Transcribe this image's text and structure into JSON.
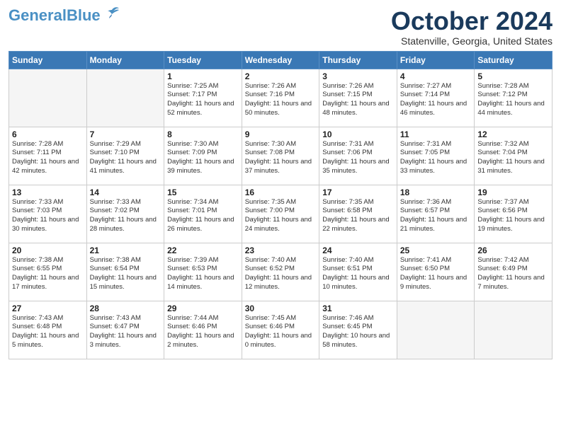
{
  "header": {
    "logo_line1": "General",
    "logo_line2": "Blue",
    "month": "October 2024",
    "location": "Statenville, Georgia, United States"
  },
  "days_of_week": [
    "Sunday",
    "Monday",
    "Tuesday",
    "Wednesday",
    "Thursday",
    "Friday",
    "Saturday"
  ],
  "weeks": [
    [
      {
        "num": "",
        "info": ""
      },
      {
        "num": "",
        "info": ""
      },
      {
        "num": "1",
        "info": "Sunrise: 7:25 AM\nSunset: 7:17 PM\nDaylight: 11 hours and 52 minutes."
      },
      {
        "num": "2",
        "info": "Sunrise: 7:26 AM\nSunset: 7:16 PM\nDaylight: 11 hours and 50 minutes."
      },
      {
        "num": "3",
        "info": "Sunrise: 7:26 AM\nSunset: 7:15 PM\nDaylight: 11 hours and 48 minutes."
      },
      {
        "num": "4",
        "info": "Sunrise: 7:27 AM\nSunset: 7:14 PM\nDaylight: 11 hours and 46 minutes."
      },
      {
        "num": "5",
        "info": "Sunrise: 7:28 AM\nSunset: 7:12 PM\nDaylight: 11 hours and 44 minutes."
      }
    ],
    [
      {
        "num": "6",
        "info": "Sunrise: 7:28 AM\nSunset: 7:11 PM\nDaylight: 11 hours and 42 minutes."
      },
      {
        "num": "7",
        "info": "Sunrise: 7:29 AM\nSunset: 7:10 PM\nDaylight: 11 hours and 41 minutes."
      },
      {
        "num": "8",
        "info": "Sunrise: 7:30 AM\nSunset: 7:09 PM\nDaylight: 11 hours and 39 minutes."
      },
      {
        "num": "9",
        "info": "Sunrise: 7:30 AM\nSunset: 7:08 PM\nDaylight: 11 hours and 37 minutes."
      },
      {
        "num": "10",
        "info": "Sunrise: 7:31 AM\nSunset: 7:06 PM\nDaylight: 11 hours and 35 minutes."
      },
      {
        "num": "11",
        "info": "Sunrise: 7:31 AM\nSunset: 7:05 PM\nDaylight: 11 hours and 33 minutes."
      },
      {
        "num": "12",
        "info": "Sunrise: 7:32 AM\nSunset: 7:04 PM\nDaylight: 11 hours and 31 minutes."
      }
    ],
    [
      {
        "num": "13",
        "info": "Sunrise: 7:33 AM\nSunset: 7:03 PM\nDaylight: 11 hours and 30 minutes."
      },
      {
        "num": "14",
        "info": "Sunrise: 7:33 AM\nSunset: 7:02 PM\nDaylight: 11 hours and 28 minutes."
      },
      {
        "num": "15",
        "info": "Sunrise: 7:34 AM\nSunset: 7:01 PM\nDaylight: 11 hours and 26 minutes."
      },
      {
        "num": "16",
        "info": "Sunrise: 7:35 AM\nSunset: 7:00 PM\nDaylight: 11 hours and 24 minutes."
      },
      {
        "num": "17",
        "info": "Sunrise: 7:35 AM\nSunset: 6:58 PM\nDaylight: 11 hours and 22 minutes."
      },
      {
        "num": "18",
        "info": "Sunrise: 7:36 AM\nSunset: 6:57 PM\nDaylight: 11 hours and 21 minutes."
      },
      {
        "num": "19",
        "info": "Sunrise: 7:37 AM\nSunset: 6:56 PM\nDaylight: 11 hours and 19 minutes."
      }
    ],
    [
      {
        "num": "20",
        "info": "Sunrise: 7:38 AM\nSunset: 6:55 PM\nDaylight: 11 hours and 17 minutes."
      },
      {
        "num": "21",
        "info": "Sunrise: 7:38 AM\nSunset: 6:54 PM\nDaylight: 11 hours and 15 minutes."
      },
      {
        "num": "22",
        "info": "Sunrise: 7:39 AM\nSunset: 6:53 PM\nDaylight: 11 hours and 14 minutes."
      },
      {
        "num": "23",
        "info": "Sunrise: 7:40 AM\nSunset: 6:52 PM\nDaylight: 11 hours and 12 minutes."
      },
      {
        "num": "24",
        "info": "Sunrise: 7:40 AM\nSunset: 6:51 PM\nDaylight: 11 hours and 10 minutes."
      },
      {
        "num": "25",
        "info": "Sunrise: 7:41 AM\nSunset: 6:50 PM\nDaylight: 11 hours and 9 minutes."
      },
      {
        "num": "26",
        "info": "Sunrise: 7:42 AM\nSunset: 6:49 PM\nDaylight: 11 hours and 7 minutes."
      }
    ],
    [
      {
        "num": "27",
        "info": "Sunrise: 7:43 AM\nSunset: 6:48 PM\nDaylight: 11 hours and 5 minutes."
      },
      {
        "num": "28",
        "info": "Sunrise: 7:43 AM\nSunset: 6:47 PM\nDaylight: 11 hours and 3 minutes."
      },
      {
        "num": "29",
        "info": "Sunrise: 7:44 AM\nSunset: 6:46 PM\nDaylight: 11 hours and 2 minutes."
      },
      {
        "num": "30",
        "info": "Sunrise: 7:45 AM\nSunset: 6:46 PM\nDaylight: 11 hours and 0 minutes."
      },
      {
        "num": "31",
        "info": "Sunrise: 7:46 AM\nSunset: 6:45 PM\nDaylight: 10 hours and 58 minutes."
      },
      {
        "num": "",
        "info": ""
      },
      {
        "num": "",
        "info": ""
      }
    ]
  ]
}
